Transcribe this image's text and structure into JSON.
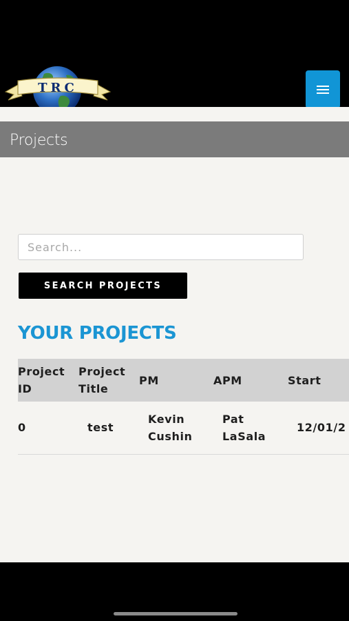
{
  "header": {
    "logo_text": "TRC",
    "menu_icon": "hamburger-menu-icon",
    "menu_color": "#1195d6"
  },
  "page": {
    "title": "Projects"
  },
  "search": {
    "placeholder": "Search...",
    "value": "",
    "button_label": "SEARCH PROJECTS"
  },
  "projects": {
    "heading": "YOUR PROJECTS",
    "heading_color": "#1b95d3",
    "columns": [
      "Project\nID",
      "Project\nTitle",
      "PM",
      "APM",
      "Start"
    ],
    "rows": [
      [
        "0",
        "test",
        "Kevin\nCushin",
        "Pat\nLaSala",
        "12/01/2"
      ]
    ]
  }
}
